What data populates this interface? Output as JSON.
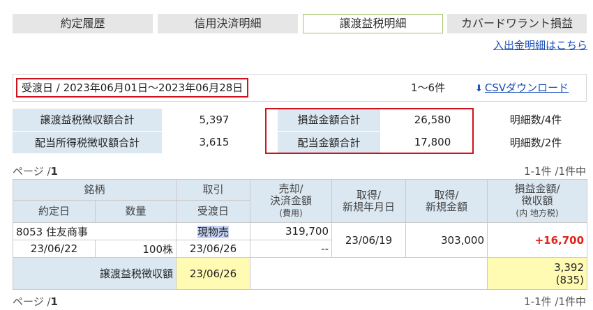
{
  "tabs": [
    {
      "label": "約定履歴",
      "active": false
    },
    {
      "label": "信用決済明細",
      "active": false
    },
    {
      "label": "譲渡益税明細",
      "active": true
    },
    {
      "label": "カバードワラント損益",
      "active": false
    }
  ],
  "io_link": "入出金明細はこちら",
  "range": {
    "text": "受渡日 / 2023年06月01日〜2023年06月28日",
    "count": "1〜6件",
    "csv_label": "CSVダウンロード"
  },
  "summary": {
    "rows": [
      {
        "l1": "譲渡益税徴収額合計",
        "v1": "5,397",
        "l2": "損益金額合計",
        "v2": "26,580",
        "cnt": "明細数/4件"
      },
      {
        "l1": "配当所得税徴収額合計",
        "v1": "3,615",
        "l2": "配当金額合計",
        "v2": "17,800",
        "cnt": "明細数/2件"
      }
    ]
  },
  "pager": {
    "page": "ページ /",
    "page_num": "1",
    "range": "1-1件 /1件中"
  },
  "detail": {
    "headers": {
      "meigara": "銘柄",
      "torihiki": "取引",
      "yakujo": "約定日",
      "suryo": "数量",
      "ukewatashi": "受渡日",
      "baikyaku_1": "売却/",
      "baikyaku_2": "決済金額",
      "baikyaku_3": "(費用)",
      "shutoku_date_1": "取得/",
      "shutoku_date_2": "新規年月日",
      "shutoku_amt_1": "取得/",
      "shutoku_amt_2": "新規金額",
      "soneki_1": "損益金額/",
      "soneki_2": "徴収額",
      "soneki_3": "(内 地方税)"
    },
    "row": {
      "name": "8053 住友商事",
      "trade": "現物売",
      "sale": "319,700",
      "cost": "--",
      "acq_date": "23/06/19",
      "acq_amt": "303,000",
      "pnl": "+16,700",
      "yakujo": "23/06/22",
      "qty": "100株",
      "ukewatashi": "23/06/26"
    },
    "tax_row": {
      "label": "譲渡益税徴収額",
      "date": "23/06/26",
      "amount": "3,392",
      "local": "(835)"
    }
  }
}
